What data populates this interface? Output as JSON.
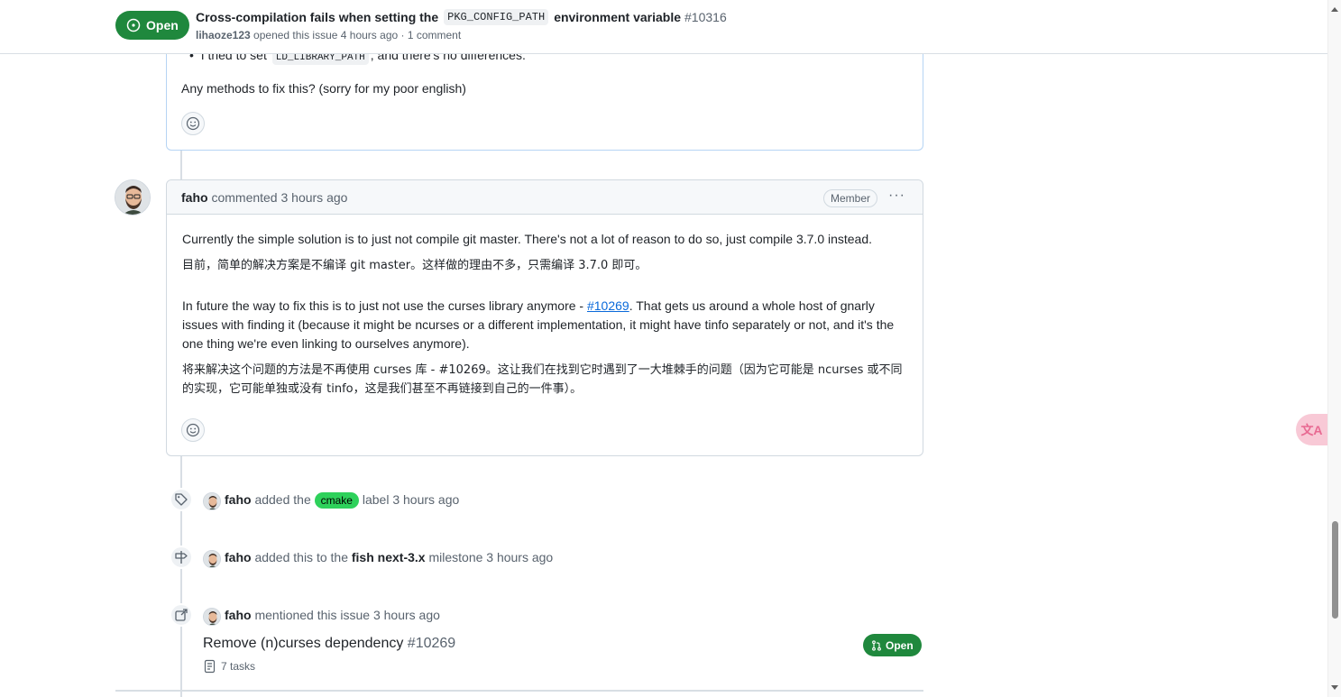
{
  "header": {
    "state": "Open",
    "title_prefix": "Cross-compilation fails when setting the",
    "title_code": "PKG_CONFIG_PATH",
    "title_suffix": "environment variable",
    "number": "#10316",
    "author": "lihaoze123",
    "meta": "opened this issue 4 hours ago · 1 comment"
  },
  "first_comment": {
    "bullet_prefix": "I tried to set",
    "bullet_code": "LD_LIBRARY_PATH",
    "bullet_suffix": ", and there's no differences.",
    "paragraph": "Any methods to fix this? (sorry for my poor english)"
  },
  "second_comment": {
    "author": "faho",
    "action": "commented 3 hours ago",
    "role_badge": "Member",
    "more_label": "···",
    "p1": "Currently the simple solution is to just not compile git master. There's not a lot of reason to do so, just compile 3.7.0 instead.",
    "p1_translation": "目前，简单的解决方案是不编译 git master。这样做的理由不多，只需编译 3.7.0 即可。",
    "p2_before_link": "In future the way to fix this is to just not use the curses library anymore - ",
    "p2_link": "#10269",
    "p2_after_link": ". That gets us around a whole host of gnarly issues with finding it (because it might be ncurses or a different implementation, it might have tinfo separately or not, and it's the one thing we're even linking to ourselves anymore).",
    "p2_translation": "将来解决这个问题的方法是不再使用 curses 库 - #10269。这让我们在找到它时遇到了一大堆棘手的问题（因为它可能是 ncurses 或不同的实现，它可能单独或没有 tinfo，这是我们甚至不再链接到自己的一件事）。"
  },
  "events": [
    {
      "icon": "tag-icon",
      "actor": "faho",
      "before": "added the",
      "label": "cmake",
      "after": "label 3 hours ago"
    },
    {
      "icon": "milestone-icon",
      "actor": "faho",
      "before": "added this to the",
      "milestone": "fish next-3.x",
      "after": "milestone 3 hours ago"
    },
    {
      "icon": "cross-reference-icon",
      "actor": "faho",
      "text": "mentioned this issue 3 hours ago"
    }
  ],
  "reference": {
    "title": "Remove (n)curses dependency",
    "number": "#10269",
    "tasks": "7 tasks",
    "state": "Open"
  },
  "translate_button": "文A",
  "colors": {
    "open_green": "#1f883d",
    "label_cmake": "#2ed15b",
    "link": "#0969da"
  }
}
